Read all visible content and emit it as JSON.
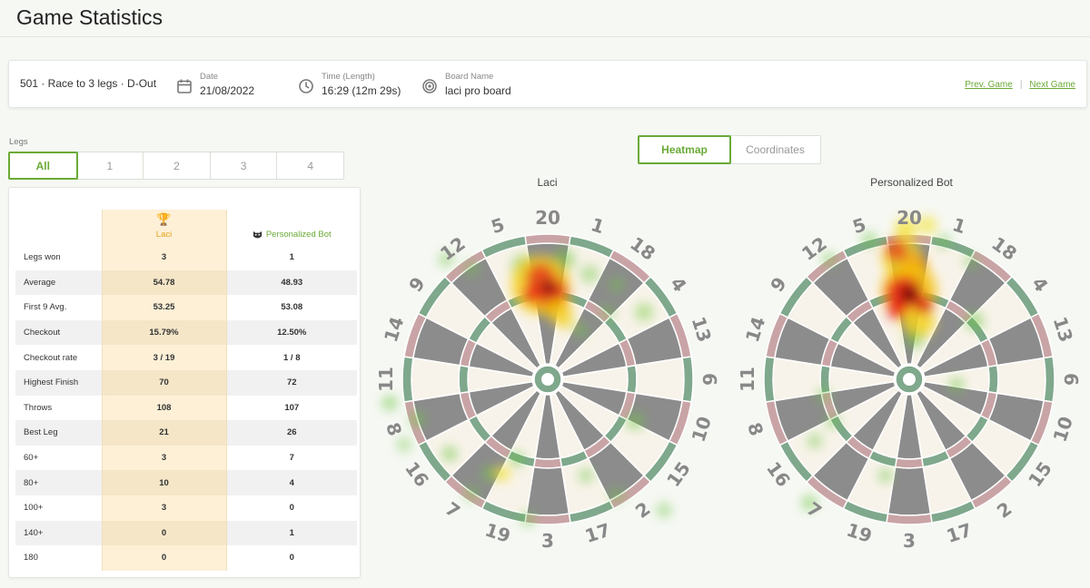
{
  "page": {
    "title": "Game Statistics"
  },
  "game_info": {
    "mode": "501 · Race to 3 legs · D-Out",
    "date_label": "Date",
    "date": "21/08/2022",
    "time_label": "Time (Length)",
    "time": "16:29 (12m 29s)",
    "board_label": "Board Name",
    "board": "laci pro board",
    "prev_game": "Prev. Game",
    "next_game": "Next Game"
  },
  "legs": {
    "label": "Legs",
    "tabs": [
      "All",
      "1",
      "2",
      "3",
      "4"
    ],
    "active": "All"
  },
  "players": {
    "p1": {
      "name": "Laci",
      "icon": "trophy-icon"
    },
    "p2": {
      "name": "Personalized Bot",
      "icon": "bot-icon"
    }
  },
  "stats": [
    {
      "label": "Legs won",
      "p1": "3",
      "p2": "1"
    },
    {
      "label": "Average",
      "p1": "54.78",
      "p2": "48.93"
    },
    {
      "label": "First 9 Avg.",
      "p1": "53.25",
      "p2": "53.08"
    },
    {
      "label": "Checkout",
      "p1": "15.79%",
      "p2": "12.50%"
    },
    {
      "label": "Checkout rate",
      "p1": "3 / 19",
      "p2": "1 / 8"
    },
    {
      "label": "Highest Finish",
      "p1": "70",
      "p2": "72"
    },
    {
      "label": "Throws",
      "p1": "108",
      "p2": "107"
    },
    {
      "label": "Best Leg",
      "p1": "21",
      "p2": "26"
    },
    {
      "label": "60+",
      "p1": "3",
      "p2": "7"
    },
    {
      "label": "80+",
      "p1": "10",
      "p2": "4"
    },
    {
      "label": "100+",
      "p1": "3",
      "p2": "0"
    },
    {
      "label": "140+",
      "p1": "0",
      "p2": "1"
    },
    {
      "label": "180",
      "p1": "0",
      "p2": "0"
    }
  ],
  "view_toggle": {
    "heatmap": "Heatmap",
    "coordinates": "Coordinates",
    "active": "Heatmap"
  },
  "boards": [
    {
      "title": "Laci"
    },
    {
      "title": "Personalized Bot"
    }
  ],
  "dartboard_numbers": [
    "20",
    "1",
    "18",
    "4",
    "13",
    "6",
    "10",
    "15",
    "2",
    "17",
    "3",
    "19",
    "7",
    "16",
    "8",
    "11",
    "14",
    "9",
    "12",
    "5"
  ],
  "colors": {
    "accent_green": "#6aaa36",
    "trophy_gold": "#e7a21c",
    "board_dark": "#8c8c8c",
    "board_light": "#f8f3ea",
    "double_red": "#c9a4a6",
    "double_green": "#7fa88c"
  }
}
